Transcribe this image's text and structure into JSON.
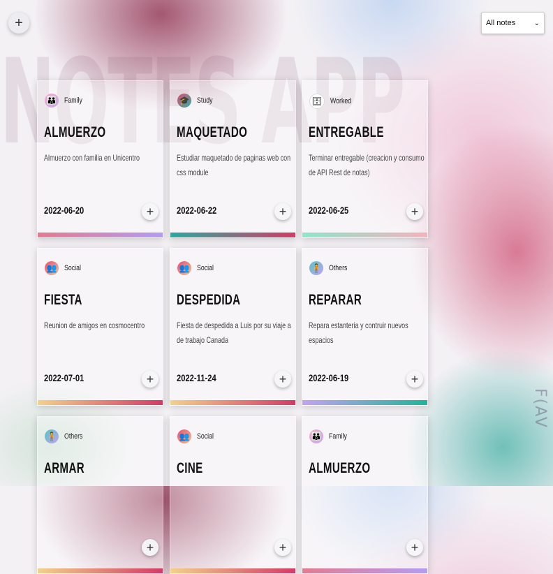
{
  "watermark": "NOTES APP",
  "side_logo": "F(AV",
  "add_button": {
    "icon": "plus-icon",
    "label": "+"
  },
  "filter": {
    "selected": "All notes",
    "chevron": "⌄"
  },
  "category_icons": {
    "Family": {
      "glyph": "👪",
      "gradient": [
        "#f7a6c8",
        "#c9a8f5"
      ]
    },
    "Study": {
      "glyph": "🎓",
      "gradient": [
        "#e2486f",
        "#2fb1a4"
      ]
    },
    "Worked": {
      "glyph": "🗄",
      "gradient": [
        "#ffffff",
        "#ffffff"
      ]
    },
    "Social": {
      "glyph": "👥",
      "gradient": [
        "#e44e76",
        "#f3c58e"
      ]
    },
    "Others": {
      "glyph": "🧍",
      "gradient": [
        "#58c4c0",
        "#c3a3f0"
      ]
    }
  },
  "notes": [
    {
      "category": "Family",
      "title": "ALMUERZO",
      "description": "Almuerzo con familia en Unicentro",
      "date": "2022-06-20",
      "bar": [
        "#e47b8f",
        "#b49cf2"
      ]
    },
    {
      "category": "Study",
      "title": "MAQUETADO",
      "description": "Estudiar maquetado de paginas web con css module",
      "date": "2022-06-22",
      "bar": [
        "#2aa9a0",
        "#d23c66"
      ]
    },
    {
      "category": "Worked",
      "title": "ENTREGABLE",
      "description": "Terminar entregable (creacion y consumo de API Rest de notas)",
      "date": "2022-06-25",
      "bar": [
        "#8ee6c9",
        "#f6b2bb"
      ]
    },
    {
      "category": "Social",
      "title": "FIESTA",
      "description": "Reunion de amigos en cosmocentro",
      "date": "2022-07-01",
      "bar": [
        "#f3d18c",
        "#d23c66"
      ]
    },
    {
      "category": "Social",
      "title": "DESPEDIDA",
      "description": "Fiesta de despedida a Luis por su viaje a de trabajo Canada",
      "date": "2022-11-24",
      "bar": [
        "#f3d18c",
        "#d23c66"
      ]
    },
    {
      "category": "Others",
      "title": "REPARAR",
      "description": "Repara estanteria y contruir nuevos espacios",
      "date": "2022-06-19",
      "bar": [
        "#c3a3f0",
        "#1fb59a"
      ]
    },
    {
      "category": "Others",
      "title": "ARMAR",
      "description": "",
      "date": "",
      "bar": [
        "#f3d18c",
        "#d23c66"
      ]
    },
    {
      "category": "Social",
      "title": "CINE",
      "description": "",
      "date": "",
      "bar": [
        "#f3d18c",
        "#d23c66"
      ]
    },
    {
      "category": "Family",
      "title": "ALMUERZO",
      "description": "",
      "date": "",
      "bar": [
        "#e47b8f",
        "#b49cf2"
      ]
    }
  ]
}
